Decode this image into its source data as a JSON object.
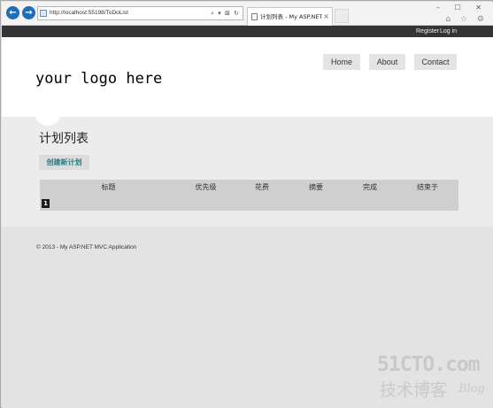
{
  "browser": {
    "back_glyph": "←",
    "forward_glyph": "→",
    "address_url": "http://localhost:55198/ToDoList",
    "address_icons": "⌕ ▾ ⊠ ↻",
    "tab_title": "计划列表 - My ASP.NET ...",
    "tab_close": "×",
    "window_buttons": "– ☐ ✕",
    "toolbar_icons": "⌂ ☆ ⚙"
  },
  "topbar": {
    "register_label": "Register",
    "login_label": "Log in"
  },
  "header": {
    "logo_text": "your logo here",
    "menu": {
      "home": "Home",
      "about": "About",
      "contact": "Contact"
    }
  },
  "main": {
    "title": "计划列表",
    "create_label": "创建新计划",
    "table": {
      "headers": {
        "title": "标题",
        "priority": "优先级",
        "cost": "花费",
        "summary": "摘要",
        "done": "完成",
        "end": "结束于"
      },
      "row_number": "1"
    }
  },
  "footer": {
    "copyright": "© 2013 - My ASP.NET MVC Application"
  },
  "watermark": {
    "site": "51CTO.com",
    "cn": "技术博客",
    "blog": "Blog"
  },
  "colors": {
    "nav_button": "#1e6fb8",
    "top_bar": "#343434",
    "create_link": "#257e80",
    "table_bg": "#cfcfcf"
  }
}
